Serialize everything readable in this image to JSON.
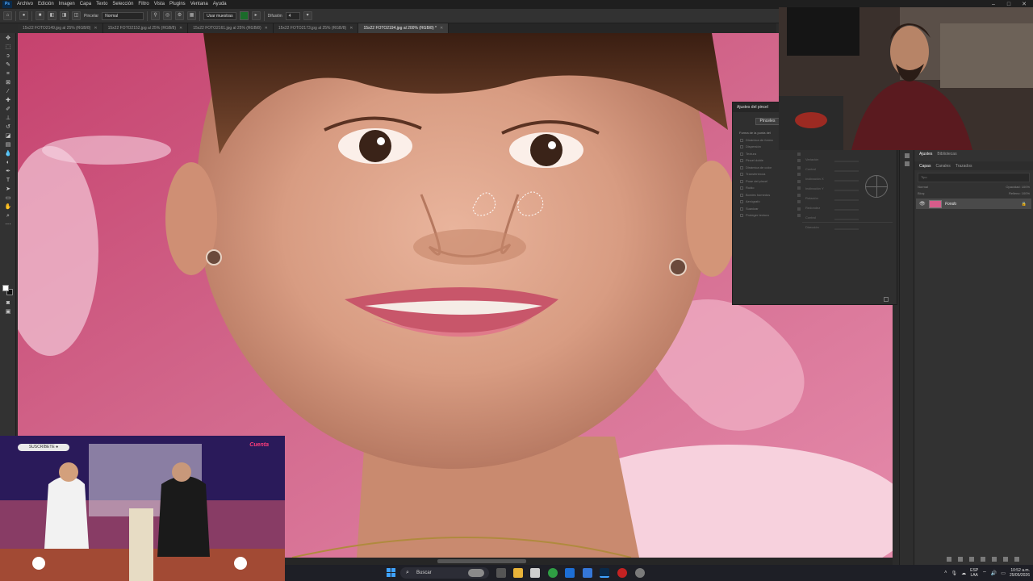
{
  "menu": {
    "items": [
      "Archivo",
      "Edición",
      "Imagen",
      "Capa",
      "Texto",
      "Selección",
      "Filtro",
      "Vista",
      "Plugins",
      "Ventana",
      "Ayuda"
    ],
    "app_icon": "Ps"
  },
  "options_bar": {
    "mode_label": "Pincelar",
    "mode_value": "Normal",
    "sample_label": "Usar muestras",
    "spread_label": "Difusión",
    "spread_value": "4",
    "source_color": "#1b6b2a"
  },
  "tabs": [
    "15x22 FOTO2149.jpg al 25% (RGB/8)",
    "15x22 FOTO2152.jpg al 25% (RGB/8)",
    "15x22 FOTO2161.jpg al 25% (RGB/8)",
    "15x22 FOTO2173.jpg al 25% (RGB/8)",
    "15x22 FOTO2194.jpg al 200% (RGB/8) *"
  ],
  "active_tab_index": 4,
  "brush_panel": {
    "title": "Ajustes del pincel",
    "brushes_button": "Pinceles",
    "list": [
      "Forma de la punta del",
      "Dinámica de forma",
      "Dispersión",
      "Textura",
      "Pincel doble",
      "Dinámica de color",
      "Transferencia",
      "Pose del pincel",
      "Ruido",
      "Bordes húmedos",
      "Aerógrafo",
      "Suavizar",
      "Proteger textura"
    ],
    "sub_labels": [
      "Variación",
      "Control",
      "Inclinación X",
      "Inclinación Y",
      "Rotación",
      "Redondez",
      "Control",
      "Dirección"
    ]
  },
  "layers_panel": {
    "top_tabs": [
      "Ajustes",
      "Bibliotecas"
    ],
    "tabs": [
      "Capas",
      "Canales",
      "Trazados"
    ],
    "filter_placeholder": "Tipo",
    "blend": "Normal",
    "opacity_label": "Opacidad:",
    "opacity_value": "100%",
    "lock_label": "Bloq:",
    "fill_label": "Relleno:",
    "fill_value": "100%",
    "layer_name": "Fondo"
  },
  "tv_overlay": {
    "badge": "SUSCRÍBETE ●",
    "logo": "Cuenta"
  },
  "taskbar": {
    "search_text": "Buscar",
    "lang": "ESP",
    "lang_sub": "LAA",
    "time": "10:52 a.m.",
    "date": "25/05/2026"
  },
  "colors": {
    "accent_blue": "#3fa2ff",
    "ps_bg": "#2b2b2b",
    "backdrop_pink": "#c55a7d"
  }
}
